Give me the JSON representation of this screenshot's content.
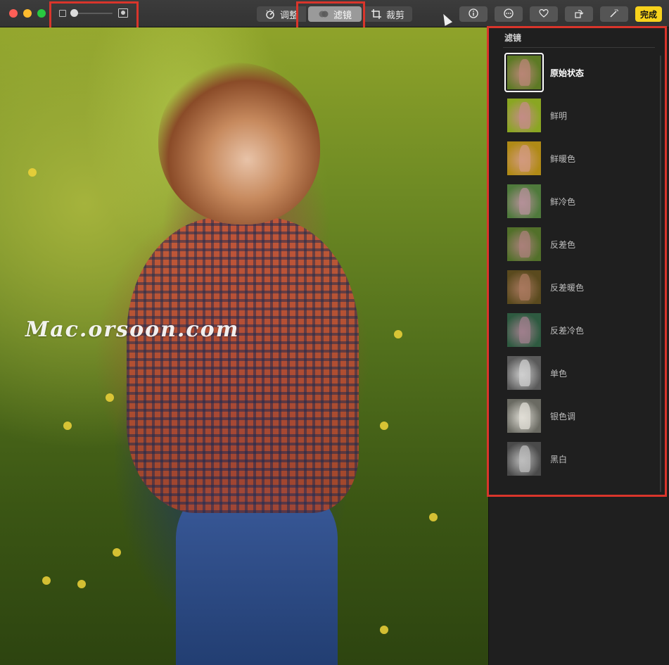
{
  "toolbar": {
    "segments": {
      "adjust_label": "调整",
      "filters_label": "滤镜",
      "crop_label": "裁剪"
    },
    "actions": [
      "info-icon",
      "more-icon",
      "heart-icon",
      "rotate-icon",
      "magic-wand-icon"
    ],
    "done_label": "完成",
    "zoom_level": 0.0
  },
  "photo": {
    "watermark": "Mac.orsoon.com"
  },
  "panel": {
    "title": "滤镜",
    "selected_index": 0,
    "filters": [
      {
        "label": "原始状态",
        "bg": "#5d7a25",
        "fig": "#b88676"
      },
      {
        "label": "鲜明",
        "bg": "#8aa622",
        "fig": "#c38c86"
      },
      {
        "label": "鲜暖色",
        "bg": "#b08a16",
        "fig": "#d29a7e"
      },
      {
        "label": "鲜冷色",
        "bg": "#4f7a3c",
        "fig": "#b49098"
      },
      {
        "label": "反差色",
        "bg": "#52702a",
        "fig": "#a9807a"
      },
      {
        "label": "反差暖色",
        "bg": "#5a4a1e",
        "fig": "#a8785e"
      },
      {
        "label": "反差冷色",
        "bg": "#2e5a40",
        "fig": "#9f7f8c"
      },
      {
        "label": "单色",
        "bg": "#5a5a5a",
        "fig": "#cfcfcf"
      },
      {
        "label": "银色调",
        "bg": "#6a6a62",
        "fig": "#e0ded6"
      },
      {
        "label": "黑白",
        "bg": "#4a4a4a",
        "fig": "#bdbdbd"
      }
    ]
  },
  "colors": {
    "done": "#f7d21c",
    "highlight_box": "#d9352b"
  }
}
